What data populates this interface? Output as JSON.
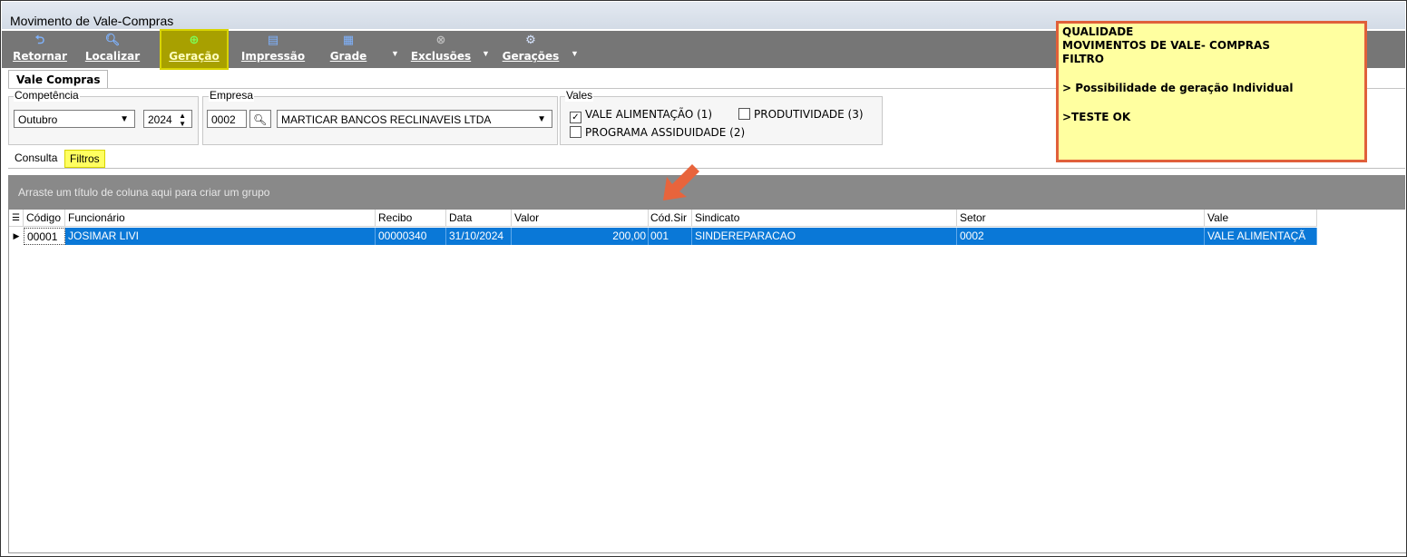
{
  "window": {
    "title": "Movimento de Vale-Compras"
  },
  "toolbar": {
    "buttons": [
      {
        "label": "Retornar",
        "icon": "back-arrow-icon"
      },
      {
        "label": "Localizar",
        "icon": "search-icon"
      },
      {
        "label": "Geração",
        "icon": "add-icon"
      },
      {
        "label": "Impressão",
        "icon": "print-icon"
      },
      {
        "label": "Grade",
        "icon": "grid-icon"
      },
      {
        "label": "Exclusões",
        "icon": "delete-icon"
      },
      {
        "label": "Gerações",
        "icon": "gear-icon"
      }
    ]
  },
  "main_tab": {
    "label": "Vale Compras"
  },
  "competencia": {
    "label": "Competência",
    "month": "Outubro",
    "year": "2024"
  },
  "empresa": {
    "label": "Empresa",
    "code": "0002",
    "name": "MARTICAR BANCOS RECLINAVEIS LTDA"
  },
  "vales": {
    "label": "Vales",
    "options": [
      {
        "label": "VALE ALIMENTAÇÃO (1)",
        "checked": true
      },
      {
        "label": "PRODUTIVIDADE (3)",
        "checked": false
      },
      {
        "label": "PROGRAMA ASSIDUIDADE (2)",
        "checked": false
      }
    ]
  },
  "subtabs": {
    "consulta": "Consulta",
    "filtros": "Filtros"
  },
  "grid": {
    "group_hint": "Arraste um título de coluna aqui para criar um grupo",
    "columns": [
      "Código",
      "Funcionário",
      "Recibo",
      "Data",
      "Valor",
      "Cód.Sir",
      "Sindicato",
      "Setor",
      "Vale"
    ],
    "rows": [
      {
        "codigo": "00001",
        "funcionario": "JOSIMAR LIVI",
        "recibo": "00000340",
        "data": "31/10/2024",
        "valor": "200,00",
        "cod_sir": "001",
        "sindicato": "SINDEREPARACAO",
        "setor": "0002",
        "vale": "VALE ALIMENTAÇÃ"
      }
    ]
  },
  "note": {
    "lines": [
      "QUALIDADE",
      "MOVIMENTOS DE VALE- COMPRAS",
      "FILTRO",
      "",
      "> Possibilidade de geração Individual",
      "",
      ">TESTE OK"
    ],
    "border_color": "#e0603a",
    "background": "#ffffa0"
  },
  "colors": {
    "selection": "#0a78d7",
    "toolbar": "#767676",
    "highlight": "#d8d400",
    "arrow": "#e8643c"
  }
}
